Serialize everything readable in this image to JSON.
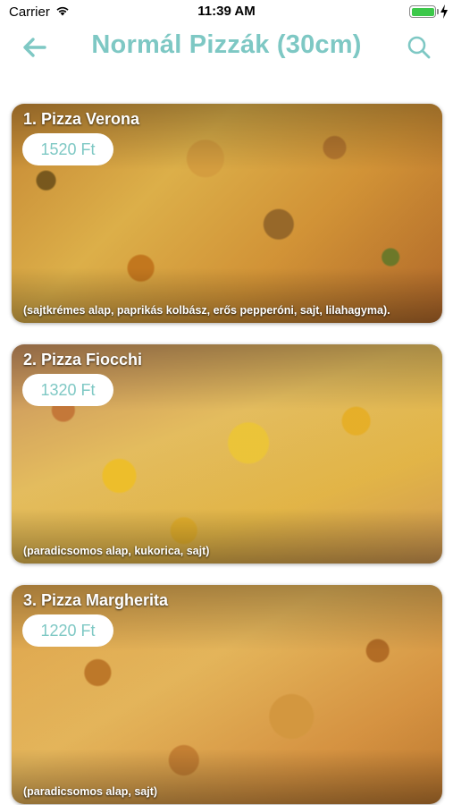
{
  "status_bar": {
    "carrier": "Carrier",
    "time": "11:39 AM",
    "battery_icon": "battery-full-charging-icon",
    "wifi_icon": "wifi-icon"
  },
  "nav": {
    "title": "Normál Pizzák (30cm)",
    "back_icon": "arrow-left-icon",
    "search_icon": "search-icon",
    "accent_color": "#7ec8c4"
  },
  "pizzas": [
    {
      "name": "1. Pizza Verona",
      "price": "1520 Ft",
      "description": "(sajtkrémes alap, paprikás kolbász, erős pepperóni, sajt, lilahagyma)."
    },
    {
      "name": "2. Pizza Fiocchi",
      "price": "1320 Ft",
      "description": "(paradicsomos alap, kukorica, sajt)"
    },
    {
      "name": "3. Pizza Margherita",
      "price": "1220 Ft",
      "description": "(paradicsomos alap, sajt)"
    }
  ]
}
